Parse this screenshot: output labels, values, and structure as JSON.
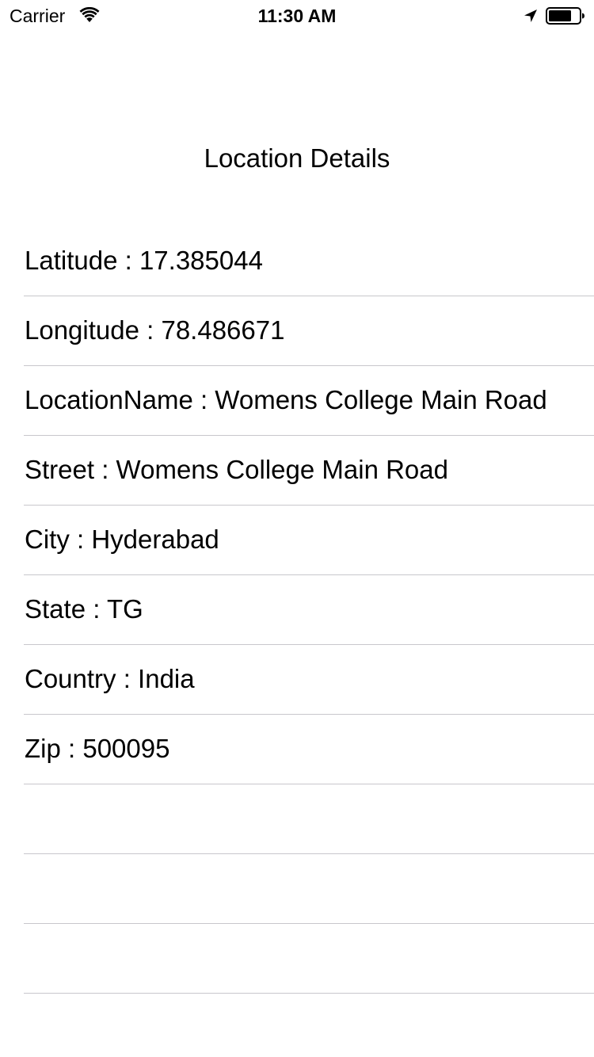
{
  "status_bar": {
    "carrier": "Carrier",
    "time": "11:30 AM",
    "icons": [
      "wifi-icon",
      "location-arrow-icon",
      "battery-icon"
    ]
  },
  "header": {
    "title": "Location Details"
  },
  "details": {
    "rows": [
      "Latitude : 17.385044",
      "Longitude : 78.486671",
      "LocationName : Womens College Main Road",
      "Street : Womens College Main Road",
      "City : Hyderabad",
      "State : TG",
      "Country : India",
      "Zip : 500095",
      "",
      "",
      ""
    ]
  },
  "colors": {
    "separator": "#c8c7cc",
    "text": "#000000",
    "background": "#ffffff"
  }
}
